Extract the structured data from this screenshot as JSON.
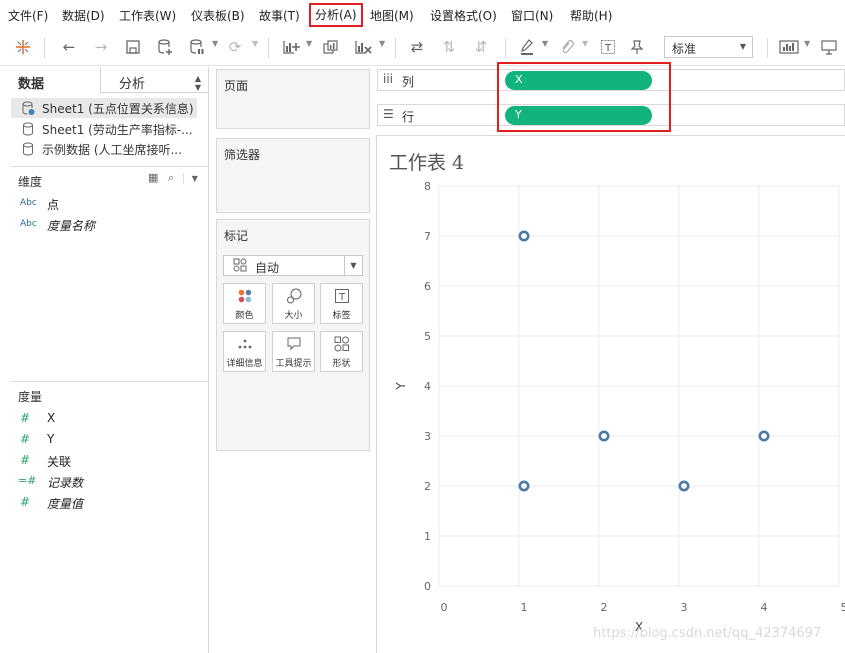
{
  "menu": {
    "file": "文件(F)",
    "data": "数据(D)",
    "worksheet": "工作表(W)",
    "dashboard": "仪表板(B)",
    "story": "故事(T)",
    "analysis": "分析(A)",
    "map": "地图(M)",
    "format": "设置格式(O)",
    "window": "窗口(N)",
    "help": "帮助(H)"
  },
  "toolbar": {
    "fit_value": "标准"
  },
  "left_pane": {
    "tab_data": "数据",
    "tab_analysis": "分析",
    "datasources": [
      {
        "label": "Sheet1 (五点位置关系信息)"
      },
      {
        "label": "Sheet1 (劳动生产率指标-..."
      },
      {
        "label": "示例数据 (人工坐席接听..."
      }
    ],
    "dimensions_title": "维度",
    "dimensions": [
      {
        "type": "Abc",
        "label": "点"
      },
      {
        "type": "Abc",
        "label": "度量名称"
      }
    ],
    "measures_title": "度量",
    "measures": [
      {
        "type": "#",
        "label": "X"
      },
      {
        "type": "#",
        "label": "Y"
      },
      {
        "type": "#",
        "label": "关联"
      },
      {
        "type": "=#",
        "label": "记录数"
      },
      {
        "type": "#",
        "label": "度量值"
      }
    ]
  },
  "cards": {
    "pages": "页面",
    "filters": "筛选器",
    "marks": "标记",
    "mark_type": "自动",
    "mark_buttons": {
      "color": "颜色",
      "size": "大小",
      "label": "标签",
      "detail": "详细信息",
      "tooltip": "工具提示",
      "shape": "形状"
    }
  },
  "shelves": {
    "columns_label": "列",
    "rows_label": "行",
    "columns_pill": "X",
    "rows_pill": "Y"
  },
  "worksheet": {
    "title": "工作表 4"
  },
  "chart_data": {
    "type": "scatter",
    "xlabel": "X",
    "ylabel": "Y",
    "xlim": [
      0,
      5
    ],
    "ylim": [
      0,
      8
    ],
    "x_ticks": [
      "0",
      "1",
      "2",
      "3",
      "4",
      "5"
    ],
    "y_ticks": [
      "0",
      "1",
      "2",
      "3",
      "4",
      "5",
      "6",
      "7",
      "8"
    ],
    "points": [
      {
        "x": 1,
        "y": 7
      },
      {
        "x": 1,
        "y": 2
      },
      {
        "x": 2,
        "y": 3
      },
      {
        "x": 3,
        "y": 2
      },
      {
        "x": 4,
        "y": 3
      }
    ],
    "marker_color": "#4e79a7",
    "marker_style": "open-circle",
    "grid": true
  },
  "watermark": "https://blog.csdn.net/qq_42374697"
}
